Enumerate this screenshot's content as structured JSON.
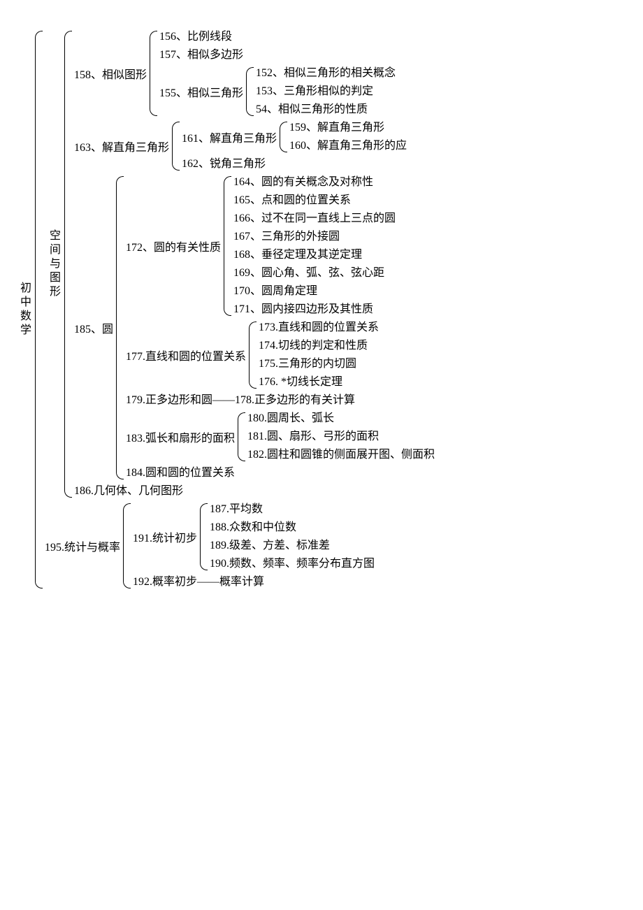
{
  "root": "初中数学",
  "space": "空间与图形",
  "n158": "158、相似图形",
  "n156": "156、比例线段",
  "n157": "157、相似多边形",
  "n155": "155、相似三角形",
  "n152": "152、相似三角形的相关概念",
  "n153": "153、三角形相似的判定",
  "n54": "54、相似三角形的性质",
  "n163": "163、解直角三角形",
  "n161": "161、解直角三角形",
  "n162": "162、锐角三角形",
  "n159": "159、解直角三角形",
  "n160": "160、解直角三角形的应",
  "n185": "185、圆",
  "n172": "172、圆的有关性质",
  "n164": "164、圆的有关概念及对称性",
  "n165": "165、点和圆的位置关系",
  "n166": "166、过不在同一直线上三点的圆",
  "n167": "167、三角形的外接圆",
  "n168": "168、垂径定理及其逆定理",
  "n169": "169、圆心角、弧、弦、弦心距",
  "n170": "170、圆周角定理",
  "n171": "171、圆内接四边形及其性质",
  "n177": "177.直线和圆的位置关系",
  "n173": "173.直线和圆的位置关系",
  "n174": "174.切线的判定和性质",
  "n175": "175.三角形的内切圆",
  "n176": "176. *切线长定理",
  "n179": "179.正多边形和圆——178.正多边形的有关计算",
  "n183": "183.弧长和扇形的面积",
  "n180": "180.圆周长、弧长",
  "n181": "181.圆、扇形、弓形的面积",
  "n182": "182.圆柱和圆锥的侧面展开图、侧面积",
  "n184": "184.圆和圆的位置关系",
  "n186": "186.几何体、几何图形",
  "n195": "195.统计与概率",
  "n191": "191.统计初步",
  "n187": "187.平均数",
  "n188": "188.众数和中位数",
  "n189": "189.级差、方差、标准差",
  "n190": "190.频数、频率、频率分布直方图",
  "n192": "192.概率初步——概率计算"
}
